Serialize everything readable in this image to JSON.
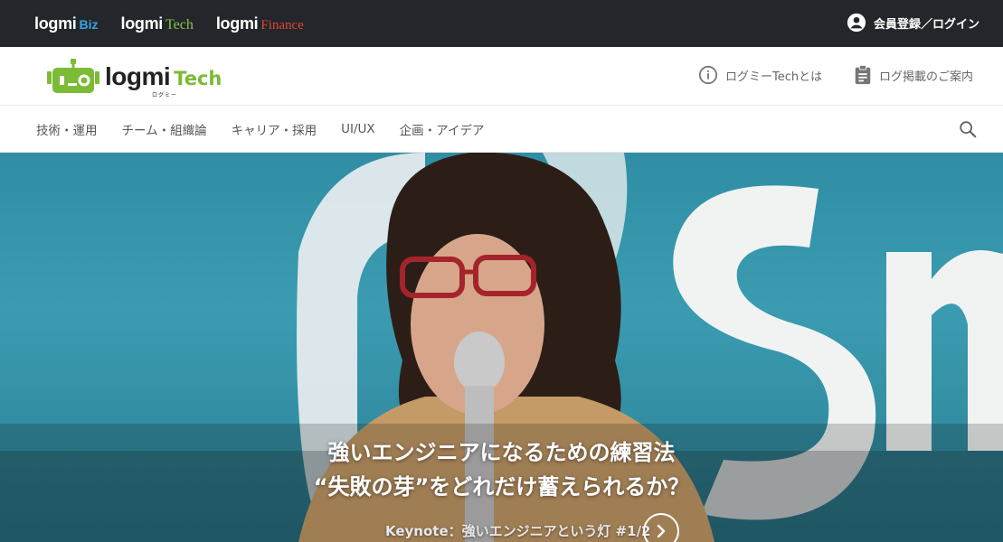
{
  "topbar": {
    "brands": [
      {
        "logmi": "logmi",
        "suffix": "Biz"
      },
      {
        "logmi": "logmi",
        "suffix": "Tech"
      },
      {
        "logmi": "logmi",
        "suffix": "Finance"
      }
    ],
    "login_label": "会員登録／ログイン"
  },
  "header": {
    "logo_logmi": "logmi",
    "logo_tech": "Tech",
    "logo_kana": "ログミー",
    "about_label": "ログミーTechとは",
    "guide_label": "ログ掲載のご案内"
  },
  "categories": [
    "技術・運用",
    "チーム・組織論",
    "キャリア・採用",
    "UI/UX",
    "企画・アイデア"
  ],
  "hero": {
    "title_line1": "強いエンジニアになるための練習法",
    "title_line2": "“失敗の芽”をどれだけ蓄えられるか？",
    "subtitle": "Keynote：強いエンジニアという灯 #1/2"
  },
  "colors": {
    "topbar_bg": "#23272b",
    "biz": "#3aa3e3",
    "tech": "#8ac34a",
    "finance": "#e0452f",
    "logo_green": "#7cbb36"
  },
  "icons": {
    "account": "account-circle-icon",
    "info": "info-icon",
    "clipboard": "clipboard-icon",
    "search": "search-icon",
    "next": "chevron-right-icon"
  }
}
